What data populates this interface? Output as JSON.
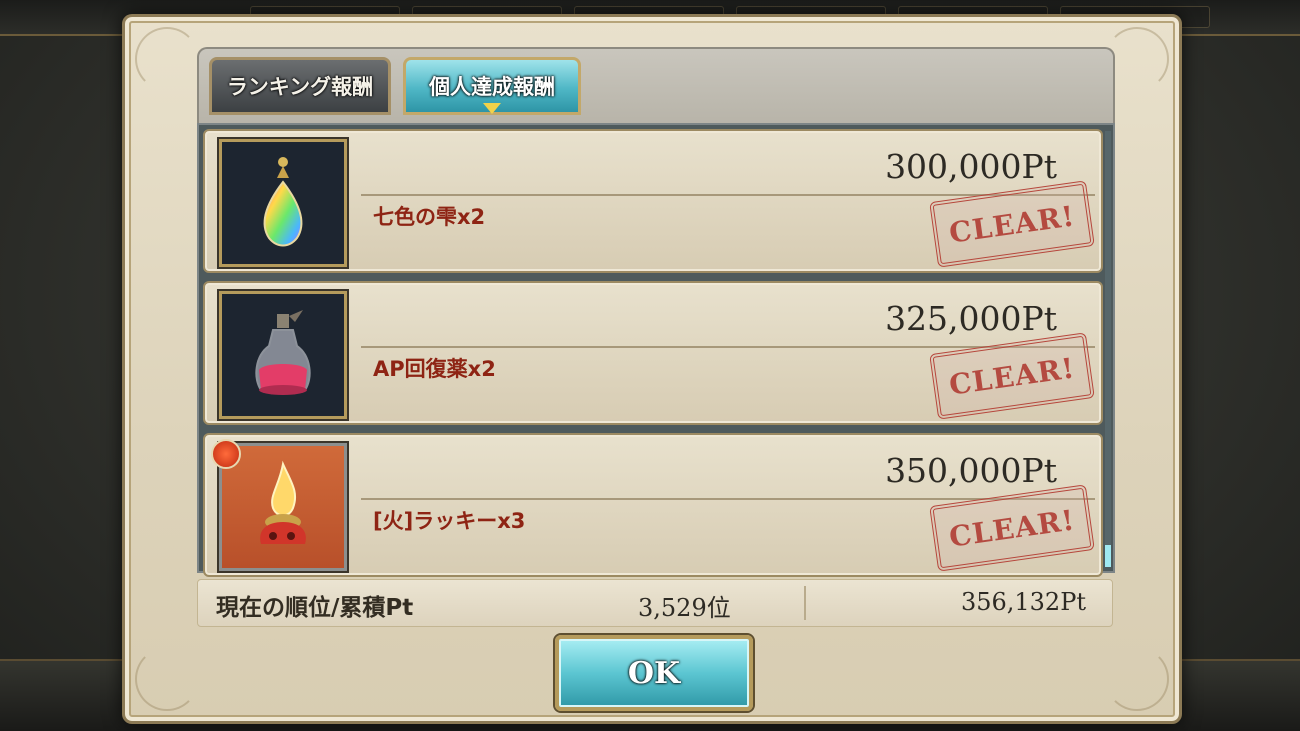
{
  "tabs": [
    {
      "label": "ランキング報酬"
    },
    {
      "label": "個人達成報酬"
    }
  ],
  "rewards": [
    {
      "points": "300,000Pt",
      "item": "七色の雫x2",
      "stamp": "CLEAR!",
      "icon": "rainbow-drop-icon"
    },
    {
      "points": "325,000Pt",
      "item": "AP回復薬x2",
      "stamp": "CLEAR!",
      "icon": "ap-potion-icon"
    },
    {
      "points": "350,000Pt",
      "item": "[火]ラッキーx3",
      "stamp": "CLEAR!",
      "icon": "fire-lucky-icon"
    }
  ],
  "status": {
    "label": "現在の順位/累積Pt",
    "rank": "3,529位",
    "points": "356,132Pt"
  },
  "ok_label": "OK"
}
